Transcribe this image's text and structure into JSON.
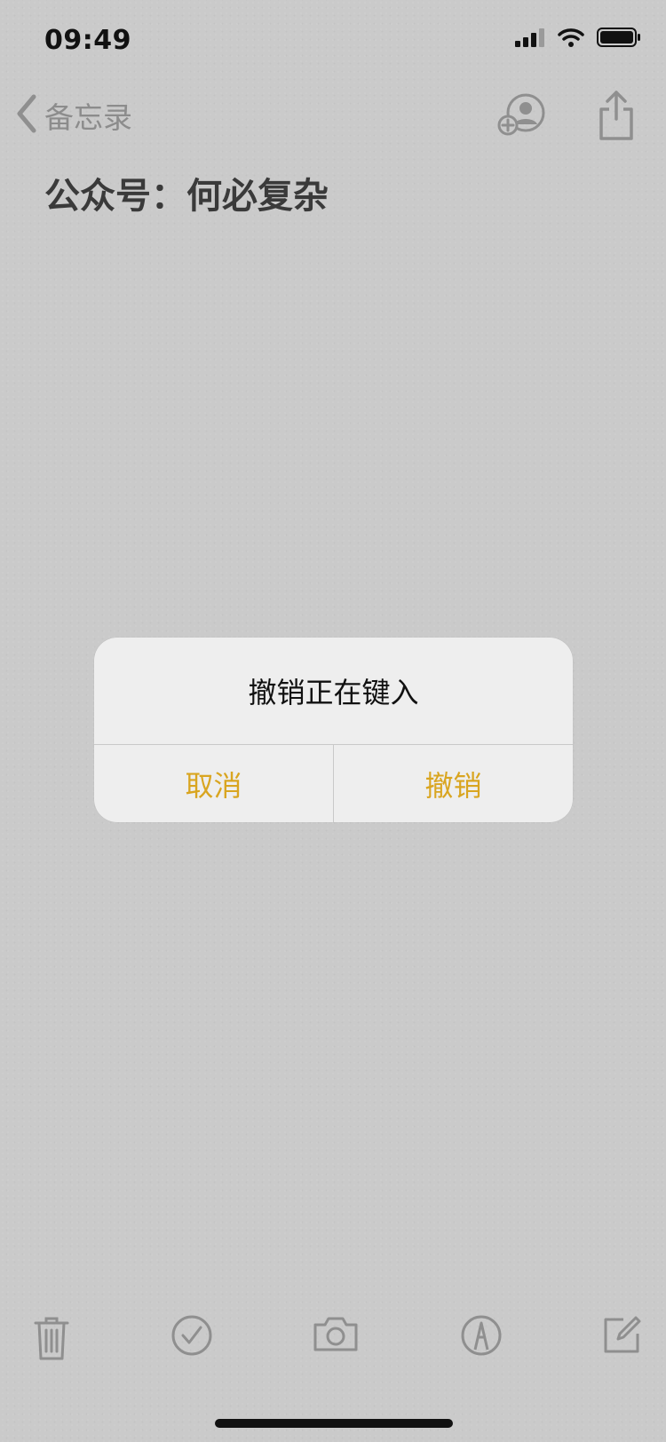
{
  "status_bar": {
    "time": "09:49",
    "icons": [
      "cellular-signal-icon",
      "wifi-icon",
      "battery-icon"
    ]
  },
  "nav": {
    "back_label": "备忘录",
    "icons": [
      "chevron-left-icon",
      "add-person-icon",
      "share-icon"
    ]
  },
  "note": {
    "title": "公众号：何必复杂"
  },
  "alert": {
    "title": "撤销正在键入",
    "cancel_label": "取消",
    "confirm_label": "撤销"
  },
  "toolbar": {
    "icons": [
      "trash-icon",
      "checklist-icon",
      "camera-icon",
      "markup-pen-icon",
      "compose-icon"
    ]
  },
  "colors": {
    "accent": "#d9a520",
    "background": "#cacaca",
    "alert_bg": "#eeeeee"
  }
}
